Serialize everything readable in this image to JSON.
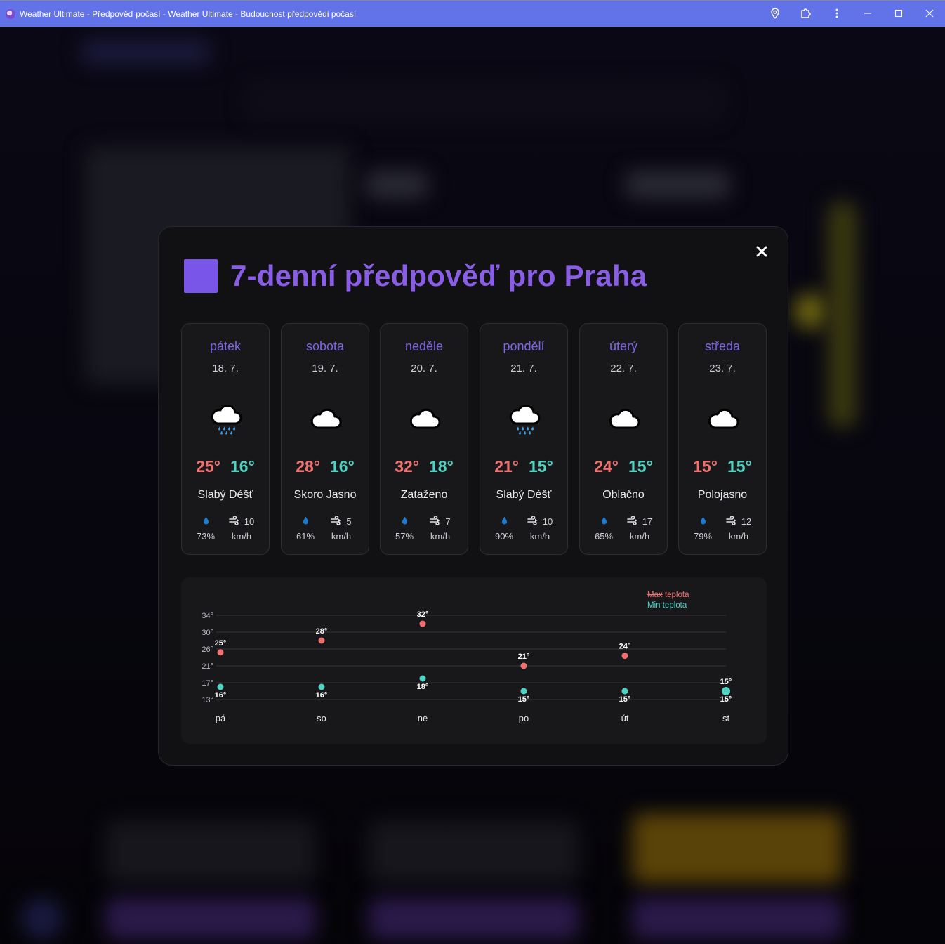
{
  "window": {
    "title": "Weather Ultimate - Předpověď počasí - Weather Ultimate - Budoucnost předpovědi počasí"
  },
  "modal": {
    "title": "7-denní předpověď pro Praha",
    "accent": "#7a56e8"
  },
  "days": [
    {
      "day": "pátek",
      "date": "18. 7.",
      "icon": "rain-cloud-icon",
      "max": "25°",
      "min": "16°",
      "desc": "Slabý Déšť",
      "humidity": "73%",
      "wind": "10",
      "wind_unit": "km/h"
    },
    {
      "day": "sobota",
      "date": "19. 7.",
      "icon": "cloud-icon",
      "max": "28°",
      "min": "16°",
      "desc": "Skoro Jasno",
      "humidity": "61%",
      "wind": "5",
      "wind_unit": "km/h"
    },
    {
      "day": "neděle",
      "date": "20. 7.",
      "icon": "cloud-icon",
      "max": "32°",
      "min": "18°",
      "desc": "Zataženo",
      "humidity": "57%",
      "wind": "7",
      "wind_unit": "km/h"
    },
    {
      "day": "pondělí",
      "date": "21. 7.",
      "icon": "rain-cloud-icon",
      "max": "21°",
      "min": "15°",
      "desc": "Slabý Déšť",
      "humidity": "90%",
      "wind": "10",
      "wind_unit": "km/h"
    },
    {
      "day": "úterý",
      "date": "22. 7.",
      "icon": "cloud-icon",
      "max": "24°",
      "min": "15°",
      "desc": "Oblačno",
      "humidity": "65%",
      "wind": "17",
      "wind_unit": "km/h"
    },
    {
      "day": "středa",
      "date": "23. 7.",
      "icon": "cloud-icon",
      "max": "15°",
      "min": "15°",
      "desc": "Polojasno",
      "humidity": "79%",
      "wind": "12",
      "wind_unit": "km/h"
    }
  ],
  "colors": {
    "max": "#f07070",
    "min": "#4fd2c2"
  },
  "chart_data": {
    "type": "scatter",
    "categories": [
      "pá",
      "so",
      "ne",
      "po",
      "út",
      "st"
    ],
    "series": [
      {
        "name": "Max teplota",
        "legend_swatch": "Max",
        "legend_label": "teplota",
        "values": [
          25,
          28,
          32,
          21,
          24,
          15
        ]
      },
      {
        "name": "Min teplota",
        "legend_swatch": "Min",
        "legend_label": "teplota",
        "values": [
          16,
          16,
          18,
          15,
          15,
          15
        ]
      }
    ],
    "yticks": [
      "34°",
      "30°",
      "26°",
      "21°",
      "17°",
      "13°"
    ],
    "ytick_values": [
      34,
      30,
      26,
      21,
      17,
      13
    ],
    "ylim": [
      13,
      34
    ],
    "grid": true,
    "legend_position": "top-right"
  }
}
